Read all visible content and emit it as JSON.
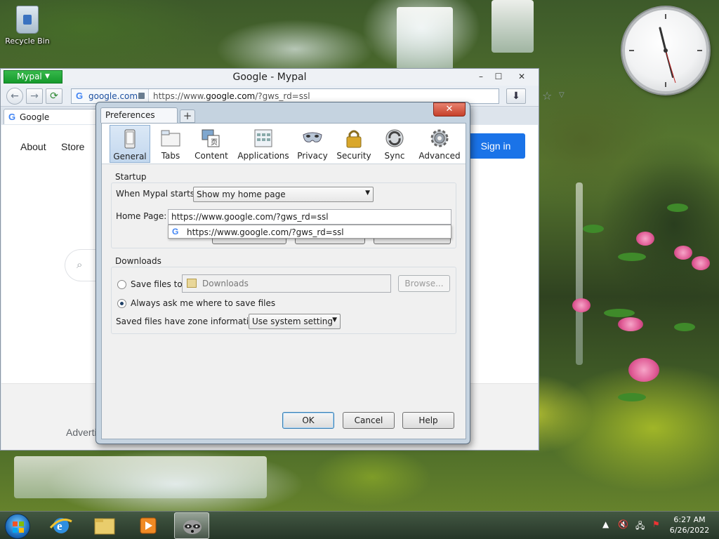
{
  "desktop": {
    "recycle_bin_label": "Recycle Bin"
  },
  "browser": {
    "app_menu_label": "Mypal",
    "window_title": "Google - Mypal",
    "url_domain": "google.com",
    "url_prefix": "https://www.",
    "url_host": "google.com",
    "url_suffix": "/?gws_rd=ssl",
    "tab_title": "Google",
    "page": {
      "about_link": "About",
      "store_link": "Store",
      "signin_button": "Sign in",
      "footer_text": "Advertis"
    }
  },
  "dialog": {
    "tab_title": "Preferences",
    "panes": [
      {
        "label": "General",
        "icon": "general-icon"
      },
      {
        "label": "Tabs",
        "icon": "tabs-icon"
      },
      {
        "label": "Content",
        "icon": "content-icon"
      },
      {
        "label": "Applications",
        "icon": "applications-icon"
      },
      {
        "label": "Privacy",
        "icon": "privacy-mask-icon"
      },
      {
        "label": "Security",
        "icon": "padlock-icon"
      },
      {
        "label": "Sync",
        "icon": "sync-icon"
      },
      {
        "label": "Advanced",
        "icon": "gear-icon"
      }
    ],
    "selected_pane": "General",
    "startup": {
      "group_title": "Startup",
      "when_starts_label": "When Mypal starts:",
      "when_starts_value": "Show my home page",
      "home_page_label": "Home Page:",
      "home_page_value": "https://www.google.com/?gws_rd=ssl",
      "suggestion": "https://www.google.com/?gws_rd=ssl"
    },
    "downloads": {
      "group_title": "Downloads",
      "save_files_label": "Save files to",
      "save_folder_value": "Downloads",
      "browse_button": "Browse...",
      "always_ask_label": "Always ask me where to save files",
      "zone_label": "Saved files have zone information:",
      "zone_value": "Use system setting",
      "save_files_selected": false,
      "always_ask_selected": true
    },
    "buttons": {
      "ok": "OK",
      "cancel": "Cancel",
      "help": "Help"
    }
  },
  "taskbar": {
    "time": "6:27 AM",
    "date": "6/26/2022"
  }
}
